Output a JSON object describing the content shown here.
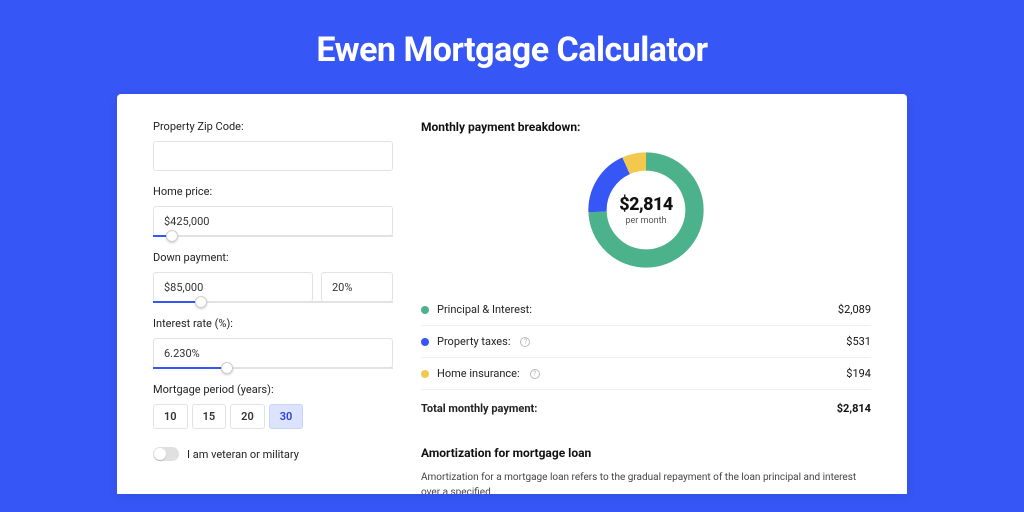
{
  "title": "Ewen Mortgage Calculator",
  "form": {
    "zip_label": "Property Zip Code:",
    "zip_value": "",
    "home_price_label": "Home price:",
    "home_price_value": "$425,000",
    "home_price_slider_pct": 8,
    "down_payment_label": "Down payment:",
    "down_payment_value": "$85,000",
    "down_payment_pct_value": "20%",
    "down_payment_slider_pct": 20,
    "rate_label": "Interest rate (%):",
    "rate_value": "6.230%",
    "rate_slider_pct": 31,
    "period_label": "Mortgage period (years):",
    "periods": [
      "10",
      "15",
      "20",
      "30"
    ],
    "period_active": "30",
    "veteran_label": "I am veteran or military"
  },
  "breakdown": {
    "title": "Monthly payment breakdown:",
    "total_display": "$2,814",
    "total_sub": "per month",
    "items": [
      {
        "label": "Principal & Interest:",
        "value": "$2,089",
        "color": "#4cb28b",
        "info": false
      },
      {
        "label": "Property taxes:",
        "value": "$531",
        "color": "#3656f5",
        "info": true
      },
      {
        "label": "Home insurance:",
        "value": "$194",
        "color": "#f2c94c",
        "info": true
      }
    ],
    "total_row": {
      "label": "Total monthly payment:",
      "value": "$2,814"
    }
  },
  "chart_data": {
    "type": "pie",
    "title": "Monthly payment breakdown",
    "series": [
      {
        "name": "Principal & Interest",
        "value": 2089,
        "color": "#4cb28b"
      },
      {
        "name": "Property taxes",
        "value": 531,
        "color": "#3656f5"
      },
      {
        "name": "Home insurance",
        "value": 194,
        "color": "#f2c94c"
      }
    ],
    "total": 2814,
    "center_labels": [
      "$2,814",
      "per month"
    ]
  },
  "amortization": {
    "title": "Amortization for mortgage loan",
    "text": "Amortization for a mortgage loan refers to the gradual repayment of the loan principal and interest over a specified"
  }
}
